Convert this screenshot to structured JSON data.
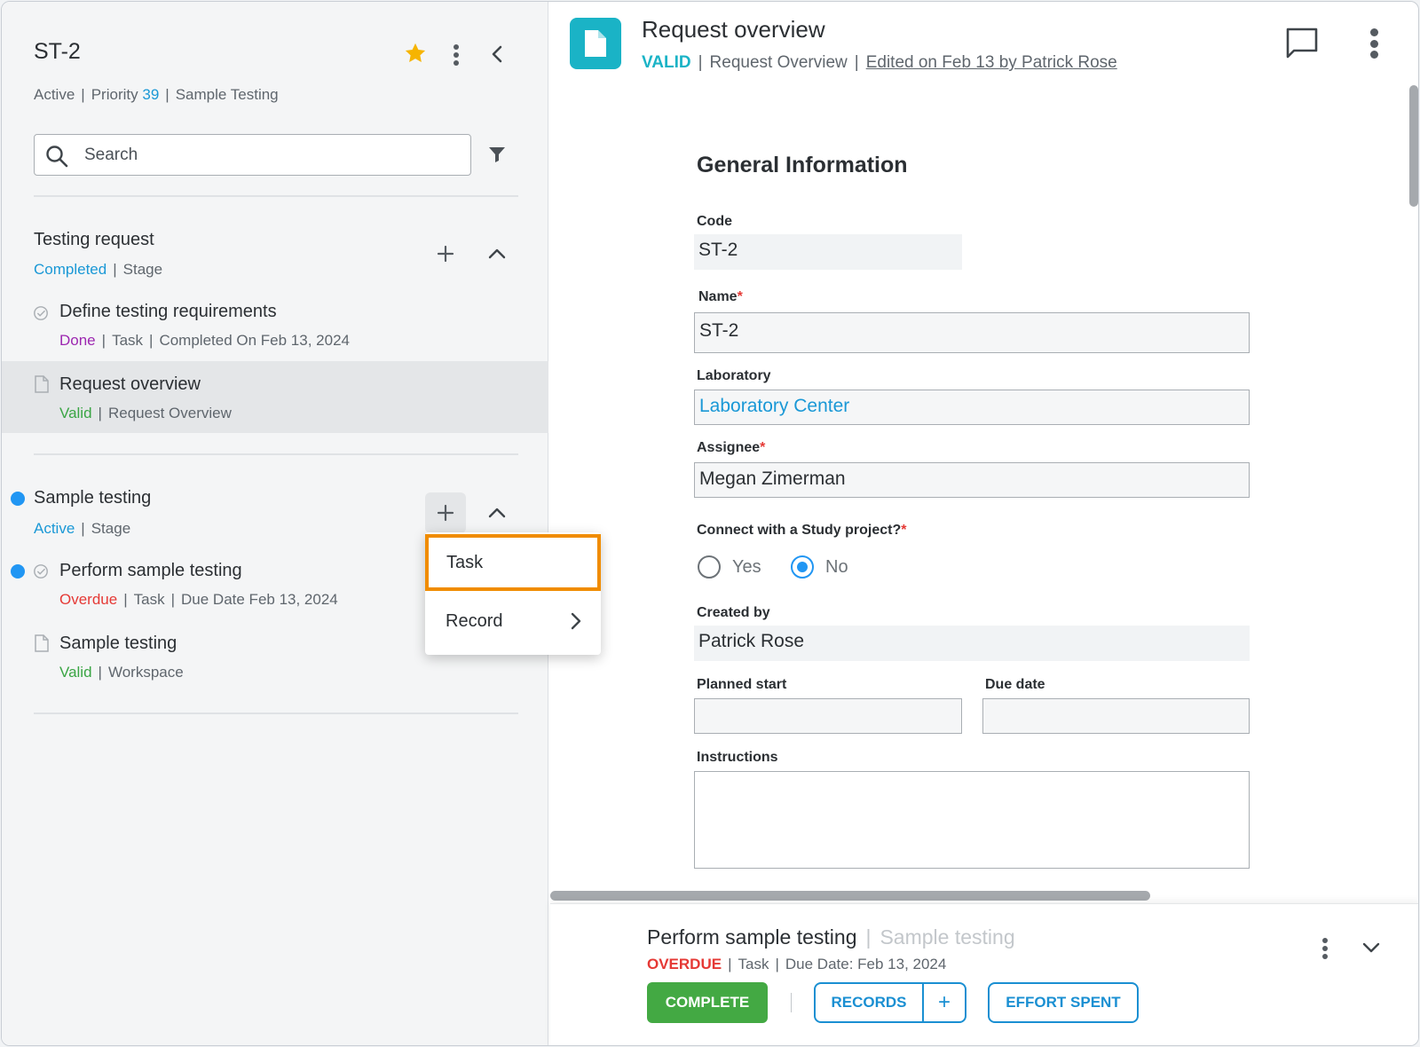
{
  "left": {
    "title": "ST-2",
    "meta": {
      "status": "Active",
      "priority_label": "Priority",
      "priority_value": "39",
      "project": "Sample Testing"
    },
    "search": {
      "placeholder": "Search"
    },
    "groups": [
      {
        "title": "Testing request",
        "status": "Completed",
        "type": "Stage",
        "items": [
          {
            "title": "Define testing requirements",
            "status": "Done",
            "type": "Task",
            "detail": "Completed On Feb 13, 2024"
          },
          {
            "title": "Request overview",
            "status": "Valid",
            "type": "Request Overview"
          }
        ]
      },
      {
        "title": "Sample testing",
        "status": "Active",
        "type": "Stage",
        "items": [
          {
            "title": "Perform sample testing",
            "status": "Overdue",
            "type": "Task",
            "detail": "Due Date Feb 13, 2024"
          },
          {
            "title": "Sample testing",
            "status": "Valid",
            "type": "Workspace"
          }
        ]
      }
    ],
    "add_menu": {
      "items": [
        "Task",
        "Record"
      ]
    }
  },
  "right": {
    "title": "Request overview",
    "status": "VALID",
    "type": "Request Overview",
    "edited": "Edited on Feb 13 by Patrick Rose",
    "section_title": "General Information",
    "fields": {
      "code": {
        "label": "Code",
        "value": "ST-2"
      },
      "name": {
        "label": "Name",
        "value": "ST-2"
      },
      "laboratory": {
        "label": "Laboratory",
        "value": "Laboratory Center"
      },
      "assignee": {
        "label": "Assignee",
        "value": "Megan Zimerman"
      },
      "connect": {
        "label": "Connect with a Study project?",
        "options": [
          "Yes",
          "No"
        ],
        "selected": "No"
      },
      "created_by": {
        "label": "Created by",
        "value": "Patrick Rose"
      },
      "planned_start": {
        "label": "Planned start",
        "value": ""
      },
      "due_date": {
        "label": "Due date",
        "value": ""
      },
      "instructions": {
        "label": "Instructions",
        "value": ""
      }
    },
    "required_mark": "*"
  },
  "bottom": {
    "title": "Perform sample testing",
    "parent": "Sample testing",
    "status": "OVERDUE",
    "type": "Task",
    "detail": "Due Date: Feb 13, 2024",
    "complete_label": "COMPLETE",
    "records_label": "RECORDS",
    "records_add": "+",
    "effort_label": "EFFORT SPENT"
  },
  "colors": {
    "accent": "#1a98d6",
    "teal": "#1ab3c6",
    "success": "#43a943",
    "danger": "#e53935",
    "highlight": "#f08c00",
    "star": "#f6b400"
  },
  "separator": "|"
}
